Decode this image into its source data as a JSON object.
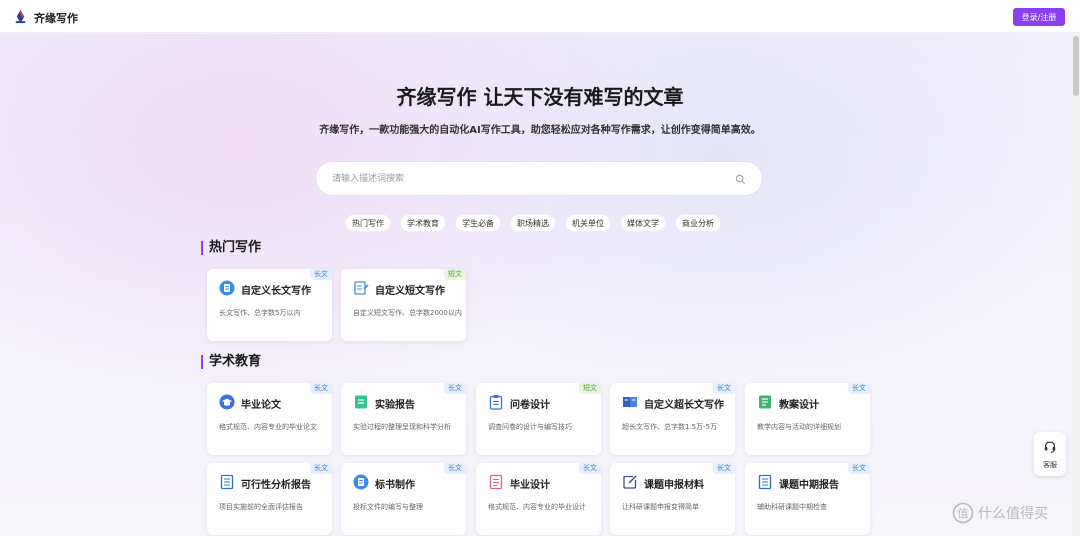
{
  "header": {
    "brand": "齐缘写作",
    "login_label": "登录/注册"
  },
  "hero": {
    "title": "齐缘写作 让天下没有难写的文章",
    "subtitle": "齐缘写作，一款功能强大的自动化AI写作工具，助您轻松应对各种写作需求，让创作变得简单高效。",
    "search_placeholder": "请输入描述词搜索"
  },
  "tags": [
    "热门写作",
    "学术教育",
    "学生必备",
    "职场精选",
    "机关单位",
    "媒体文学",
    "商业分析"
  ],
  "sections": {
    "hot": {
      "title": "热门写作",
      "cards": [
        {
          "title": "自定义长文写作",
          "desc": "长文写作、总字数5万以内",
          "badge": "长文",
          "icon": "document-circle-icon"
        },
        {
          "title": "自定义短文写作",
          "desc": "自定义短文写作、总字数2000以内",
          "badge": "短文",
          "icon": "edit-document-icon"
        }
      ]
    },
    "academic": {
      "title": "学术教育",
      "cards": [
        {
          "title": "毕业论文",
          "desc": "格式规范、内容专业的毕业论文",
          "badge": "长文",
          "icon": "graduation-cap-icon"
        },
        {
          "title": "实验报告",
          "desc": "实验过程的整理呈现和科学分析",
          "badge": "长文",
          "icon": "report-icon"
        },
        {
          "title": "问卷设计",
          "desc": "调查问卷的设计与编写技巧",
          "badge": "短文",
          "icon": "clipboard-icon"
        },
        {
          "title": "自定义超长文写作",
          "desc": "超长文写作、总字数1.5万-5万",
          "badge": "长文",
          "icon": "book-icon"
        },
        {
          "title": "教案设计",
          "desc": "教学内容与活动的详细规划",
          "badge": "长文",
          "icon": "lesson-plan-icon"
        },
        {
          "title": "可行性分析报告",
          "desc": "项目实施前的全面评估报告",
          "badge": "长文",
          "icon": "analysis-report-icon"
        },
        {
          "title": "标书制作",
          "desc": "投标文件的编写与整理",
          "badge": "长文",
          "icon": "bid-document-icon"
        },
        {
          "title": "毕业设计",
          "desc": "格式规范、内容专业的毕业设计",
          "badge": "长文",
          "icon": "design-document-icon"
        },
        {
          "title": "课题申报材料",
          "desc": "让科研课题申报变得简单",
          "badge": "长文",
          "icon": "pen-square-icon"
        },
        {
          "title": "课题中期报告",
          "desc": "辅助科研课题中期检查",
          "badge": "长文",
          "icon": "midterm-report-icon"
        }
      ]
    }
  },
  "support": {
    "label": "客服"
  },
  "watermark": {
    "text": "什么值得买"
  },
  "colors": {
    "accent": "#8a3ff0",
    "badge_long": "#3a7be0",
    "badge_short": "#53a52b"
  }
}
